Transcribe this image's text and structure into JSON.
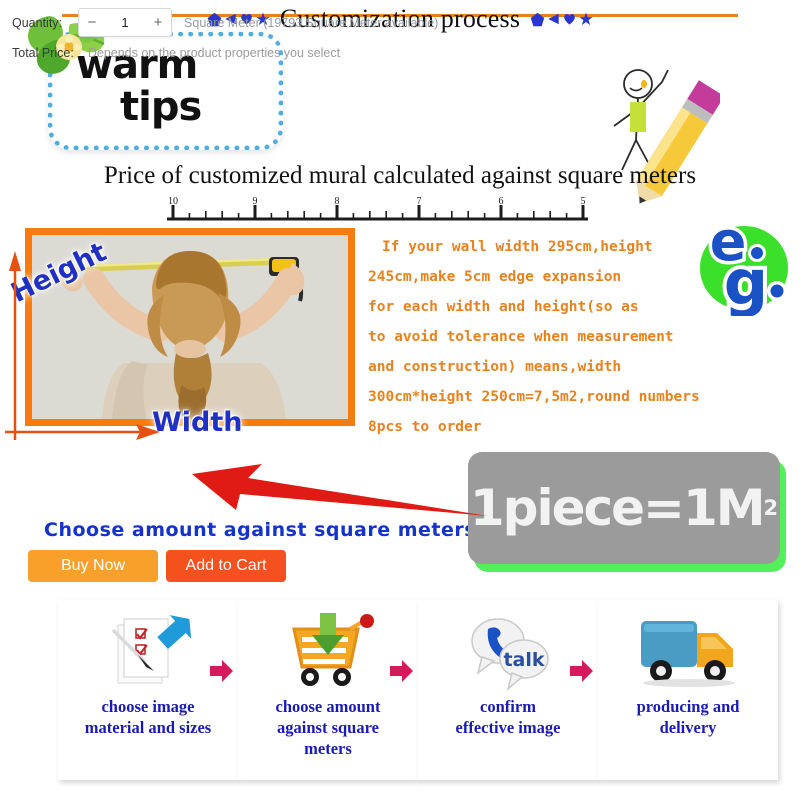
{
  "header": {
    "title": "Customization process",
    "deco_left": [
      "pentagon-icon",
      "triangle-icon",
      "heart-icon",
      "star-icon"
    ],
    "deco_right": [
      "pentagon-icon",
      "triangle-icon",
      "heart-icon",
      "star-icon"
    ],
    "rule_color": "#E8821E"
  },
  "tips": {
    "line1": "warm",
    "line2": "tips",
    "border_color": "#4FADE0"
  },
  "subtitle": "Price of customized mural calculated against square meters",
  "ruler": {
    "ticks": [
      "10",
      "9",
      "8",
      "7",
      "6",
      "5"
    ]
  },
  "photo": {
    "height_label": "Height",
    "width_label": "Width",
    "frame_color": "#F57C0D",
    "label_color": "#2130C4"
  },
  "notice": {
    "color": "#E8821E",
    "lines": [
      "If your wall width 295cm,height",
      "245cm,make 5cm edge expansion",
      "for each width and height(so as",
      "to avoid tolerance when measurement",
      "and construction) means,width",
      "300cm*height 250cm=7,5m2,round numbers",
      "8pcs to order"
    ]
  },
  "eg_logo": {
    "letter_e": "e",
    "letter_g": "g",
    "circle_color": "#3BE02B",
    "letter_color": "#1A51C4"
  },
  "form": {
    "quantity_label": "Quantity:",
    "minus_label": "−",
    "plus_label": "+",
    "quantity_value": "1",
    "unit_text": "Square Meter (19793 Square Meter available)",
    "total_price_label": "Total Price:",
    "total_price_value": "Depends on the product properties you select"
  },
  "blue_caption": "Choose amount against square meters",
  "buttons": {
    "buy_now": "Buy Now",
    "add_to_cart": "Add to Cart",
    "buy_now_color": "#F9A02B",
    "add_to_cart_color": "#F4511E"
  },
  "callout": {
    "text": "1piece=1M",
    "superscript": "2",
    "box_color": "#9B9B9B",
    "shadow_color": "#54F05B",
    "arrow_color": "#E01B16"
  },
  "steps": [
    {
      "icon": "document-checklist-icon",
      "label": "choose image\nmaterial and sizes"
    },
    {
      "icon": "shopping-cart-download-icon",
      "label": "choose amount\nagainst square\nmeters"
    },
    {
      "icon": "talk-bubble-phone-icon",
      "label": "confirm\neffective image"
    },
    {
      "icon": "delivery-truck-icon",
      "label": "producing and\ndelivery"
    }
  ],
  "step_arrow_color": "#D41A5B"
}
